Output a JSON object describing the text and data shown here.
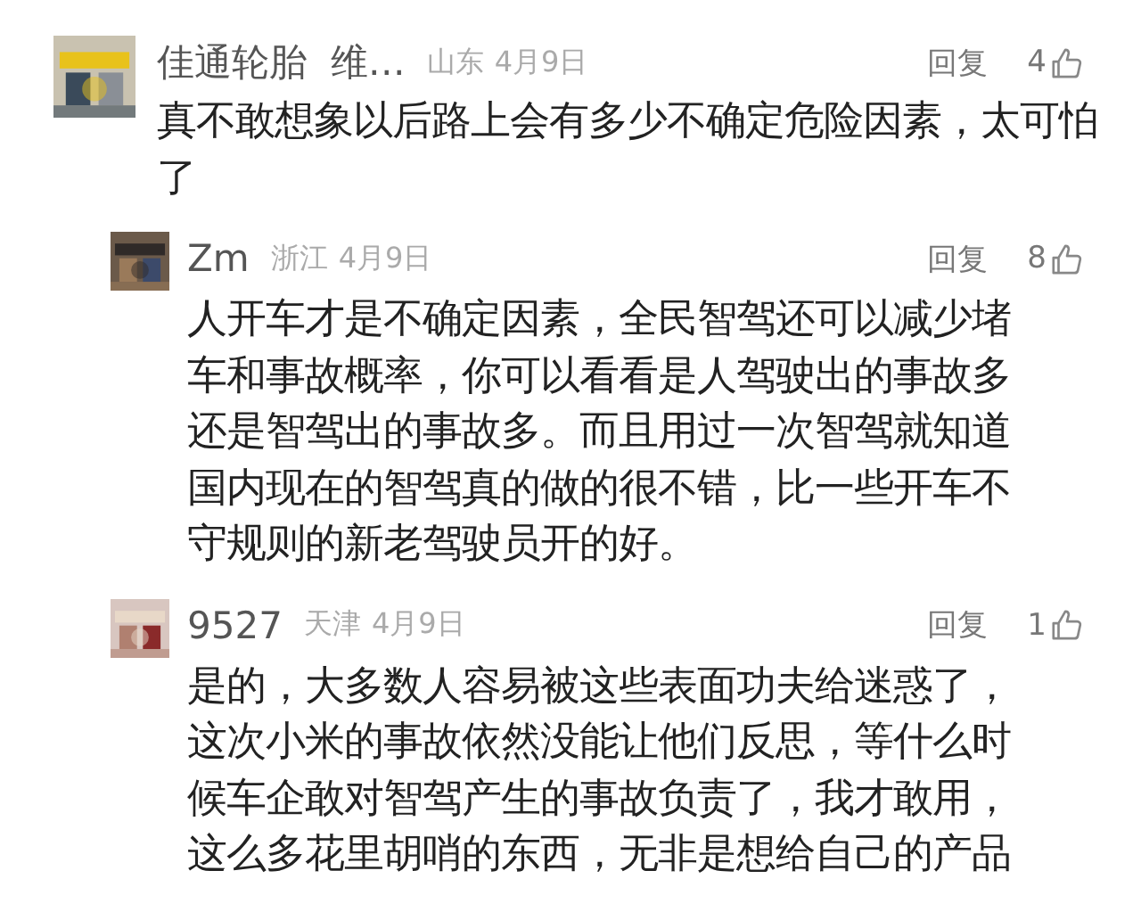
{
  "comments": [
    {
      "name": "佳通轮胎  维…",
      "location": "山东",
      "date": "4月9日",
      "reply_label": "回复",
      "likes": "4",
      "text": "真不敢想象以后路上会有多少不确定危险因素，太可怕了",
      "children": [
        {
          "name": "Zm",
          "location": "浙江",
          "date": "4月9日",
          "reply_label": "回复",
          "likes": "8",
          "text": "人开车才是不确定因素，全民智驾还可以减少堵车和事故概率，你可以看看是人驾驶出的事故多还是智驾出的事故多。而且用过一次智驾就知道国内现在的智驾真的做的很不错，比一些开车不守规则的新老驾驶员开的好。"
        },
        {
          "name": "9527",
          "location": "天津",
          "date": "4月9日",
          "reply_label": "回复",
          "likes": "1",
          "text": "是的，大多数人容易被这些表面功夫给迷惑了，这次小米的事故依然没能让他们反思，等什么时候车企敢对智驾产生的事故负责了，我才敢用，这么多花里胡哨的东西，无非是想给自己的产品"
        }
      ]
    }
  ]
}
